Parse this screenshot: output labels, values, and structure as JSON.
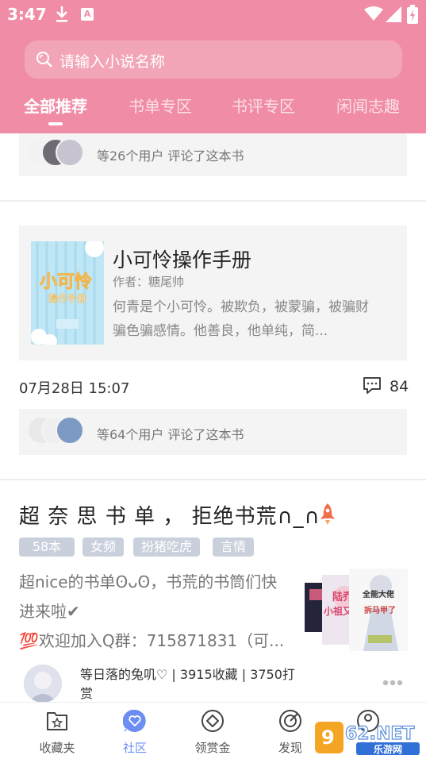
{
  "status_bar": {
    "time": "3:47"
  },
  "search": {
    "placeholder": "请输入小说名称"
  },
  "tabs": [
    {
      "label": "全部推荐",
      "active": true
    },
    {
      "label": "书单专区",
      "active": false
    },
    {
      "label": "书评专区",
      "active": false
    },
    {
      "label": "闲闻志趣",
      "active": false
    }
  ],
  "feed": {
    "top_commenters": {
      "text": "等26个用户 评论了这本书"
    },
    "book_post": {
      "book": {
        "title": "小可怜操作手册",
        "author": "作者：糖尾帅",
        "description": "何青是个小可怜。被欺负，被蒙骗，被骗财骗色骗感情。他善良，他单纯，简...",
        "cover_text": "小可怜操作手册"
      },
      "date": "07月28日 15:07",
      "comment_count": "84",
      "commenters": {
        "text": "等64个用户 评论了这本书"
      }
    },
    "book_list_post": {
      "title": "超 奈 思 书 单 ， 拒绝书荒∩_∩",
      "tags": [
        "58本",
        "女频",
        "扮猪吃虎",
        "言情"
      ],
      "description_lines": [
        "超nice的书单ʘᴗʘ，书荒的书筒们快",
        "进来啦✔",
        "💯欢迎加入Q群：715871831（可..."
      ],
      "cover_texts": [
        "陆乔小祖又撩",
        "全能大佬拆马甲了"
      ],
      "user_info": "等日落的兔叽♡ | 3915收藏 | 3750打赏"
    }
  },
  "bottom_nav": [
    {
      "label": "收藏夹",
      "icon": "bookmark-folder-icon",
      "active": false
    },
    {
      "label": "社区",
      "icon": "community-heart-icon",
      "active": true
    },
    {
      "label": "领赏金",
      "icon": "reward-coin-icon",
      "active": false
    },
    {
      "label": "发现",
      "icon": "discover-compass-icon",
      "active": false
    },
    {
      "label": "我的",
      "icon": "profile-icon",
      "active": false
    }
  ],
  "watermark": {
    "text": "962.NET",
    "subtext": "乐游网"
  },
  "colors": {
    "header_pink": "#f08ca5",
    "active_nav": "#6c8ef2",
    "tag_bg": "#c9d0dc",
    "rocket": "#f06e4a"
  }
}
